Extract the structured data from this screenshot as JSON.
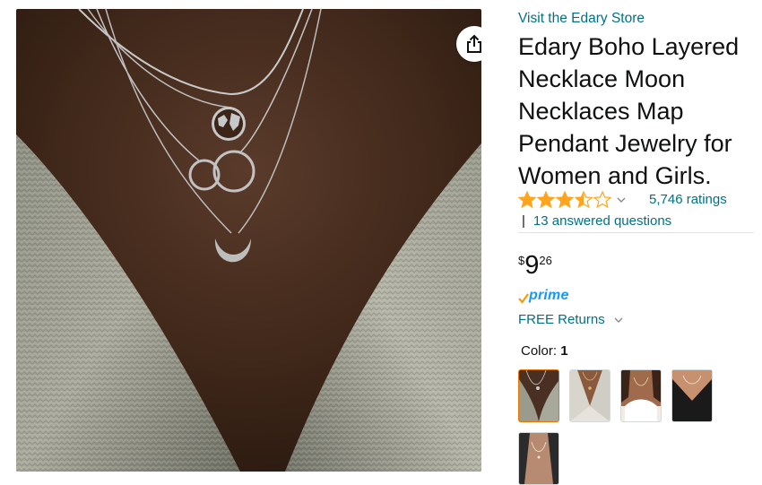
{
  "product": {
    "store_link": "Visit the Edary Store",
    "title": "Edary Boho Layered Necklace Moon Necklaces Map Pendant Jewelry for Women and Girls.",
    "rating_value": 3.5,
    "ratings_count": "5,746 ratings",
    "qa_separator": "|",
    "answered_questions": "13 answered questions",
    "price": {
      "symbol": "$",
      "whole": "9",
      "fraction": "26"
    },
    "prime": "prime",
    "returns": "FREE Returns",
    "color_label": "Color:",
    "color_value": "1"
  },
  "swatches": [
    {
      "name": "swatch-1",
      "selected": true
    },
    {
      "name": "swatch-2",
      "selected": false
    },
    {
      "name": "swatch-3",
      "selected": false
    },
    {
      "name": "swatch-4",
      "selected": false
    },
    {
      "name": "swatch-5",
      "selected": false
    }
  ],
  "colors": {
    "link": "#007185",
    "text": "#0f1111",
    "star": "#ffa41c",
    "prime_blue": "#1399ff",
    "prime_check": "#ff9900",
    "selected_border": "#e77600"
  },
  "icons": {
    "share": "share-icon",
    "star_full": "star-full-icon",
    "star_half": "star-half-icon",
    "star_empty": "star-empty-icon",
    "chevron": "chevron-down-icon",
    "prime_check": "prime-check-icon"
  }
}
